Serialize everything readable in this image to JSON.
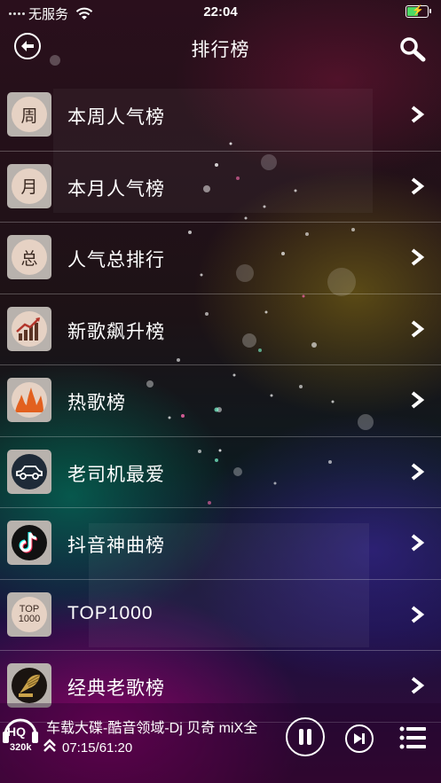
{
  "status_bar": {
    "carrier": "无服务",
    "time": "22:04",
    "icons": [
      "signal-dots-icon",
      "wifi-icon",
      "battery-charging-icon"
    ]
  },
  "header": {
    "title": "排行榜",
    "back_icon": "back-arrow-icon",
    "search_icon": "search-icon"
  },
  "charts": [
    {
      "label": "本周人气榜",
      "icon_text": "周",
      "icon": "week-badge-icon"
    },
    {
      "label": "本月人气榜",
      "icon_text": "月",
      "icon": "month-badge-icon"
    },
    {
      "label": "人气总排行",
      "icon_text": "总",
      "icon": "total-badge-icon"
    },
    {
      "label": "新歌飙升榜",
      "icon_text": "",
      "icon": "rising-chart-icon"
    },
    {
      "label": "热歌榜",
      "icon_text": "",
      "icon": "flame-icon"
    },
    {
      "label": "老司机最爱",
      "icon_text": "",
      "icon": "car-icon"
    },
    {
      "label": "抖音神曲榜",
      "icon_text": "",
      "icon": "tiktok-icon"
    },
    {
      "label": "TOP1000",
      "icon_text_1": "TOP",
      "icon_text_2": "1000",
      "icon": "top1000-badge-icon"
    },
    {
      "label": "经典老歌榜",
      "icon_text": "",
      "icon": "gramophone-icon"
    }
  ],
  "player": {
    "quality": "HQ",
    "bitrate": "320k",
    "song_title": "车载大碟-酷音领域-Dj 贝奇 miX全",
    "time": "07:15/61:20",
    "progress": 0.118,
    "icons": [
      "hq-headphones-icon",
      "expand-up-icon",
      "pause-icon",
      "next-icon",
      "playlist-icon"
    ]
  },
  "colors": {
    "badge_bg": "#b8b2ad",
    "badge_circle": "#e6d2c4",
    "accent_battery": "#4cd964",
    "text": "#ffffff"
  }
}
